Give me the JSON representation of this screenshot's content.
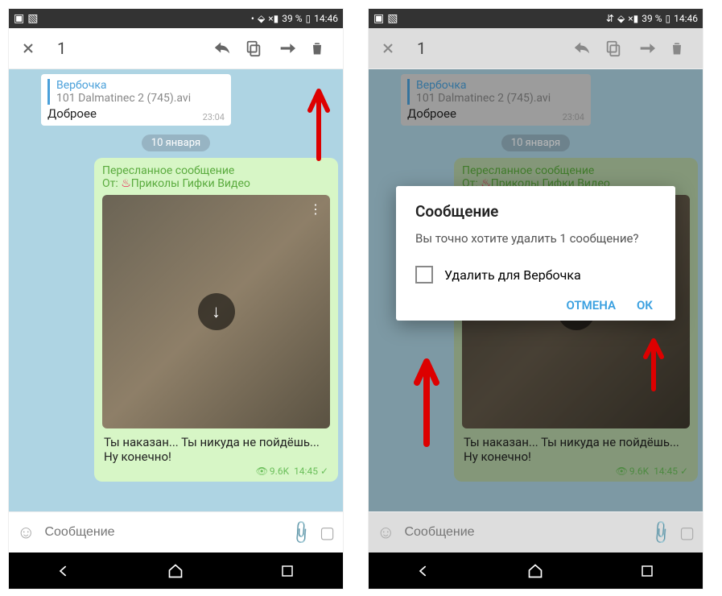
{
  "statusbar": {
    "battery": "39 %",
    "time": "14:46",
    "wifi": "wifi",
    "signal": "×"
  },
  "toolbar": {
    "selected_count": "1"
  },
  "reply": {
    "name": "Вербочка",
    "file": "101 Dalmatinec 2 (745).avi",
    "text": "Доброее",
    "time": "23:04"
  },
  "date_chip": "10 января",
  "message": {
    "forward_label": "Пересланное сообщение",
    "forward_from_prefix": "От: ",
    "forward_channel": "Приколы Гифки Видео",
    "caption": "Ты наказан... Ты никуда не пойдёшь... Ну конечно!",
    "views": "9.6K",
    "time": "14:45"
  },
  "compose": {
    "placeholder": "Сообщение"
  },
  "dialog": {
    "title": "Сообщение",
    "text": "Вы точно хотите удалить 1 сообщение?",
    "checkbox_label": "Удалить для Вербочка",
    "cancel": "ОТМЕНА",
    "ok": "ОК"
  }
}
